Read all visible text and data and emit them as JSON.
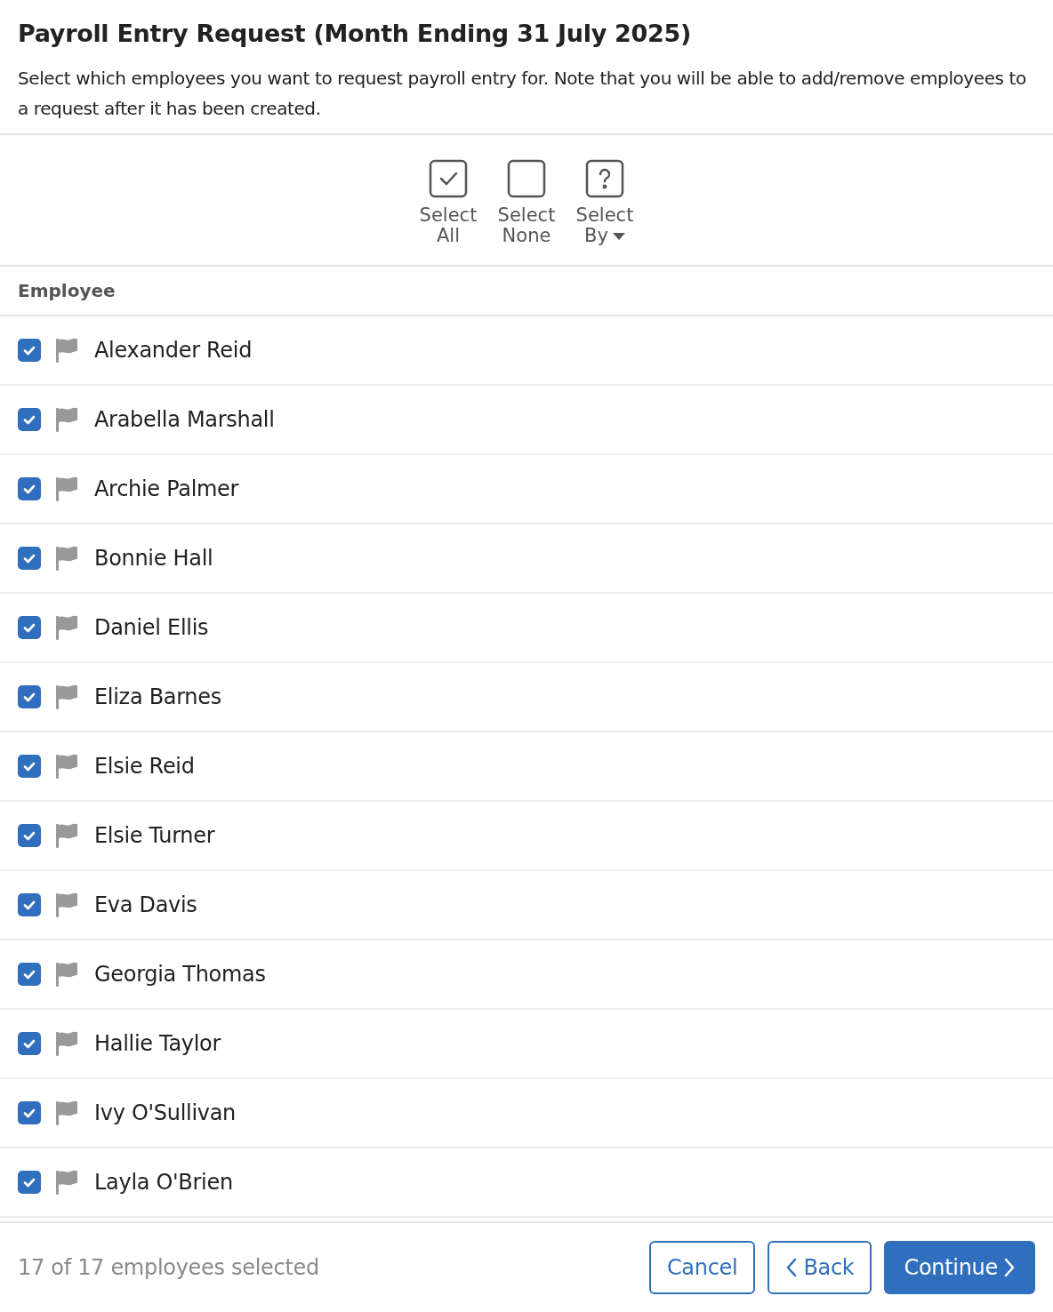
{
  "title": "Payroll Entry Request (Month Ending 31 July 2025)",
  "description": "Select which employees you want to request payroll entry for. Note that you will be able to add/remove employees to a request after it has been created.",
  "toolbar": [
    {
      "kind": "all",
      "line1": "Select",
      "line2": "All",
      "dropdown": false
    },
    {
      "kind": "none",
      "line1": "Select",
      "line2": "None",
      "dropdown": false
    },
    {
      "kind": "by",
      "line1": "Select",
      "line2": "By",
      "dropdown": true
    }
  ],
  "column_header": "Employee",
  "employees": [
    {
      "name": "Alexander Reid",
      "checked": true
    },
    {
      "name": "Arabella Marshall",
      "checked": true
    },
    {
      "name": "Archie Palmer",
      "checked": true
    },
    {
      "name": "Bonnie Hall",
      "checked": true
    },
    {
      "name": "Daniel Ellis",
      "checked": true
    },
    {
      "name": "Eliza Barnes",
      "checked": true
    },
    {
      "name": "Elsie Reid",
      "checked": true
    },
    {
      "name": "Elsie Turner",
      "checked": true
    },
    {
      "name": "Eva Davis",
      "checked": true
    },
    {
      "name": "Georgia Thomas",
      "checked": true
    },
    {
      "name": "Hallie Taylor",
      "checked": true
    },
    {
      "name": "Ivy O'Sullivan",
      "checked": true
    },
    {
      "name": "Layla O'Brien",
      "checked": true
    }
  ],
  "footer": {
    "status": "17 of 17 employees selected",
    "buttons": [
      {
        "kind": "cancel",
        "label": "Cancel"
      },
      {
        "kind": "back",
        "label": "Back"
      },
      {
        "kind": "continue",
        "label": "Continue"
      }
    ]
  }
}
